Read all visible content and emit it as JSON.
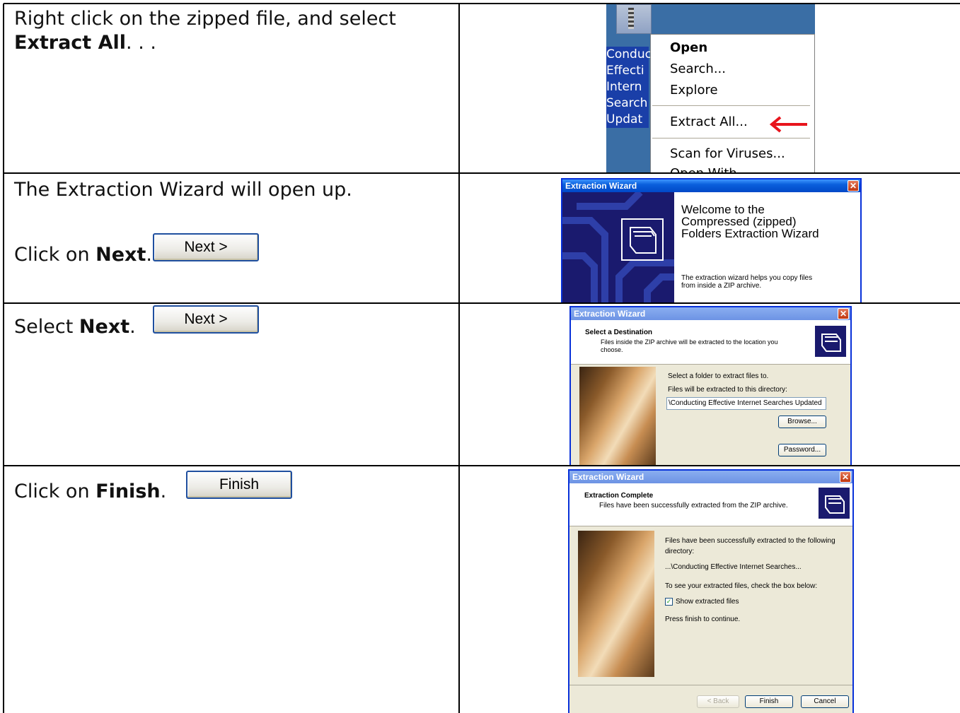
{
  "steps": [
    {
      "line1": "Right click on the zipped file, and select",
      "bold": "Extract All",
      "after": ". . ."
    },
    {
      "line1": "The Extraction Wizard will open up.",
      "prefix": "Click on ",
      "bold": "Next",
      "after": ".",
      "button": "Next >"
    },
    {
      "prefix": "Select ",
      "bold": "Next",
      "after": ".",
      "button": "Next >"
    },
    {
      "prefix": "Click on ",
      "bold": "Finish",
      "after": ".",
      "button": "Finish"
    }
  ],
  "context_menu": {
    "desktop_label": [
      "Conduc",
      "Effecti",
      "Intern",
      "Search",
      "Updat"
    ],
    "items": [
      "Open",
      "Search...",
      "Explore",
      "Extract All...",
      "Scan for Viruses...",
      "Open With"
    ]
  },
  "wizard_welcome": {
    "title": "Extraction Wizard",
    "heading": "Welcome to the Compressed (zipped) Folders Extraction Wizard",
    "body1": "The extraction wizard helps you copy files",
    "body2": "from inside a ZIP archive."
  },
  "wizard_destination": {
    "title": "Extraction Wizard",
    "heading": "Select a Destination",
    "sub1": "Files inside the ZIP archive will be extracted to the location you",
    "sub2": "choose.",
    "select_label": "Select a folder to extract files to.",
    "dir_label": "Files will be extracted to this directory:",
    "path_value": "\\Conducting Effective Internet Searches Updated",
    "browse": "Browse...",
    "password": "Password..."
  },
  "wizard_complete": {
    "title": "Extraction Wizard",
    "heading": "Extraction Complete",
    "sub": "Files have been successfully extracted from the ZIP archive.",
    "line1": "Files have been successfully extracted to the following",
    "line2": "directory:",
    "path": "...\\Conducting Effective Internet Searches...",
    "see": "To see your extracted files, check the box below:",
    "checkbox_label": "Show extracted files",
    "checked": true,
    "press": "Press finish to continue.",
    "back": "< Back",
    "finish": "Finish",
    "cancel": "Cancel"
  }
}
